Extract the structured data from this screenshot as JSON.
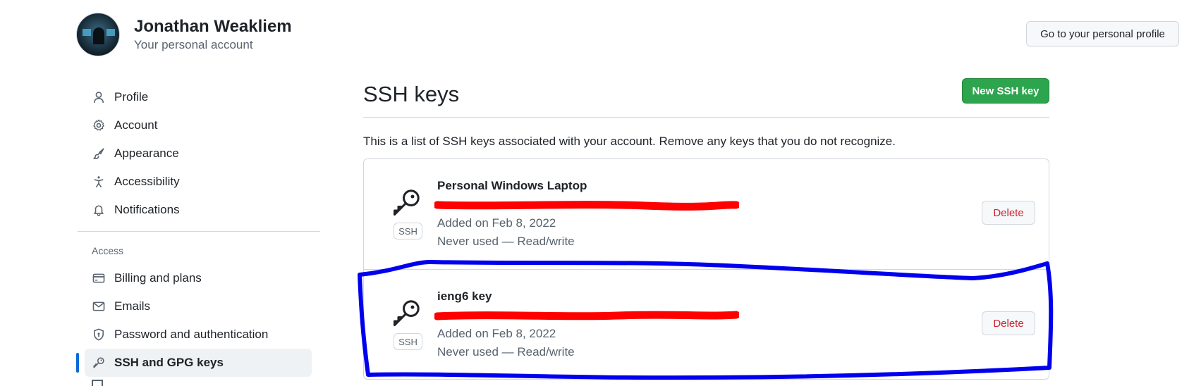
{
  "header": {
    "name": "Jonathan Weakliem",
    "subtitle": "Your personal account",
    "profile_button": "Go to your personal profile"
  },
  "sidebar": {
    "items": [
      {
        "label": "Profile",
        "icon": "person-icon"
      },
      {
        "label": "Account",
        "icon": "gear-icon"
      },
      {
        "label": "Appearance",
        "icon": "paintbrush-icon"
      },
      {
        "label": "Accessibility",
        "icon": "accessibility-icon"
      },
      {
        "label": "Notifications",
        "icon": "bell-icon"
      }
    ],
    "access_heading": "Access",
    "access_items": [
      {
        "label": "Billing and plans",
        "icon": "credit-card-icon"
      },
      {
        "label": "Emails",
        "icon": "mail-icon"
      },
      {
        "label": "Password and authentication",
        "icon": "shield-lock-icon"
      },
      {
        "label": "SSH and GPG keys",
        "icon": "key-icon",
        "active": true
      }
    ]
  },
  "main": {
    "title": "SSH keys",
    "new_key_button": "New SSH key",
    "description": "This is a list of SSH keys associated with your account. Remove any keys that you do not recognize.",
    "keys": [
      {
        "title": "Personal Windows Laptop",
        "badge": "SSH",
        "added": "Added on Feb 8, 2022",
        "usage": "Never used — Read/write",
        "delete": "Delete"
      },
      {
        "title": "ieng6 key",
        "badge": "SSH",
        "added": "Added on Feb 8, 2022",
        "usage": "Never used — Read/write",
        "delete": "Delete"
      }
    ]
  },
  "colors": {
    "accent": "#0969da",
    "primary_button": "#2da44e",
    "danger": "#cf222e",
    "redaction": "#ff0000",
    "annotation": "#0000ee"
  }
}
